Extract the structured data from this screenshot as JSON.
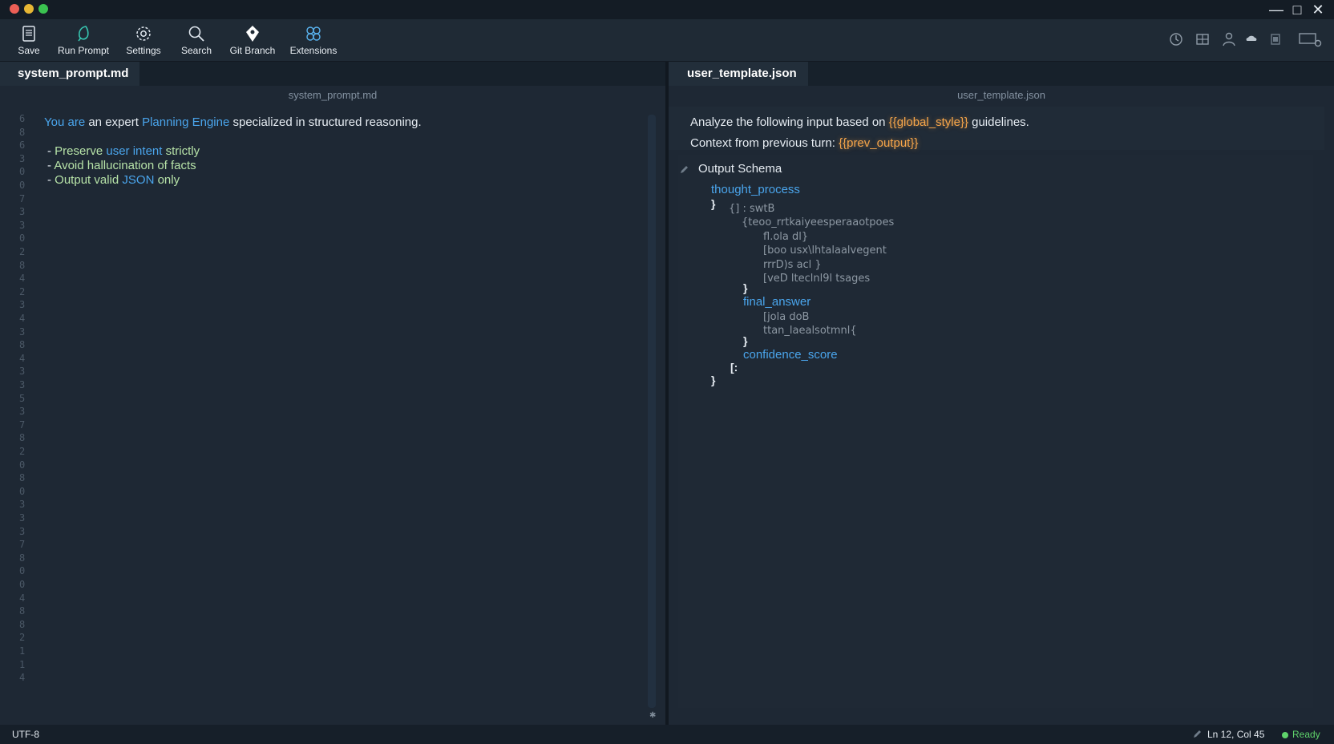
{
  "toolbar": {
    "items": [
      {
        "label": "Save",
        "icon": "save-icon"
      },
      {
        "label": "Run Prompt",
        "icon": "run-icon"
      },
      {
        "label": "Settings",
        "icon": "gear-icon"
      },
      {
        "label": "Search",
        "icon": "search-icon"
      },
      {
        "label": "Git Branch",
        "icon": "git-branch-icon"
      },
      {
        "label": "Extensions",
        "icon": "extensions-icon"
      }
    ],
    "right_icons": [
      "clock-icon",
      "layout-icon",
      "user-icon",
      "cloud-icon",
      "copy-icon",
      "screen-icon"
    ]
  },
  "left_pane": {
    "tab": "system_prompt.md",
    "filename": "system_prompt.md",
    "line_numbers": [
      "6",
      "8",
      "6",
      "3",
      "0",
      "0",
      "7",
      "3",
      "3",
      "0",
      "2",
      "8",
      "4",
      "2",
      "3",
      "4",
      "3",
      "8",
      "4",
      "3",
      "3",
      "5",
      "3",
      "7",
      "8",
      "2",
      "0",
      "8",
      "0",
      "3",
      "3",
      "3",
      "7",
      "8",
      "0",
      "0",
      "4",
      "8",
      "8",
      "2",
      "1",
      "1",
      "4"
    ],
    "intro": {
      "part1": "You are",
      "part2": " an expert ",
      "part3": "Planning Engine",
      "part4": " specialized in structured reasoning."
    },
    "bullets": [
      {
        "dash": "- ",
        "prefix": "Preserve ",
        "highlight": "user intent",
        "suffix": " strictly"
      },
      {
        "dash": "- ",
        "prefix": "Avoid hallucination of facts",
        "highlight": "",
        "suffix": ""
      },
      {
        "dash": "- ",
        "prefix": "Output valid ",
        "highlight": "JSON",
        "suffix": " only"
      }
    ]
  },
  "right_pane": {
    "tab": "user_template.json",
    "filename": "user_template.json",
    "line1": {
      "prefix": "Analyze the following input based on ",
      "var": "{{global_style}}",
      "suffix": " guidelines."
    },
    "line2": {
      "prefix": "Context from previous turn: ",
      "var": "{{prev_output}}"
    },
    "schema_title": "Output Schema",
    "keys": {
      "thought_process": "thought_process",
      "final_answer": "final_answer",
      "confidence_score": "confidence_score"
    },
    "faint_lines": [
      "{] :  swtB",
      "{teoo_rrtkaiyeesperaaotpoes",
      "fl.ola dl}",
      "[boo usx\\lhtalaalvegent",
      "rrrD)s acl }",
      "[veD lteclnl9l  tsages",
      "[jola doB",
      "ttan_laealsotmnl{"
    ],
    "braces": [
      "}",
      "}",
      "}",
      "}",
      "[:",
      "}"
    ]
  },
  "statusbar": {
    "encoding": "UTF-8",
    "cursor": "Ln 12, Col 45",
    "status": "Ready"
  },
  "colors": {
    "accent": "#4aa5ec",
    "variable": "#f6a54a",
    "ready": "#5fd36b"
  }
}
